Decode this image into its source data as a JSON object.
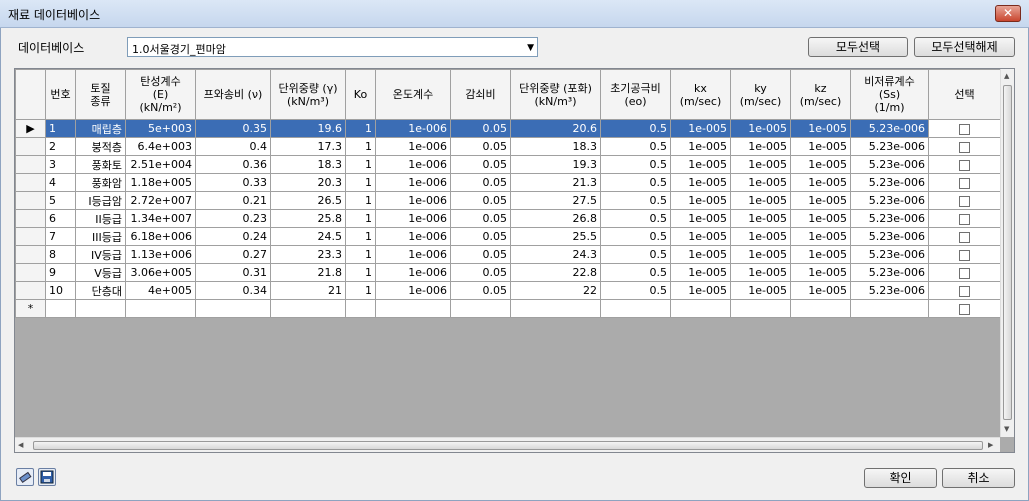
{
  "window": {
    "title": "재료 데이터베이스",
    "close_label": "✕"
  },
  "database": {
    "label": "데이터베이스",
    "selected": "1.0서울경기_편마암"
  },
  "buttons": {
    "select_all": "모두선택",
    "deselect_all": "모두선택해제",
    "ok": "확인",
    "cancel": "취소"
  },
  "headers": {
    "no": "번호",
    "soil": [
      "토질",
      "종류"
    ],
    "elastic": [
      "탄성계수",
      "(E)",
      "(kN/m²)"
    ],
    "poisson": "프와송비 (ν)",
    "unit_weight": [
      "단위중량 (γ)",
      "(kN/m³)"
    ],
    "ko": "Ko",
    "temp": "온도계수",
    "damping": "감쇠비",
    "sat_weight": [
      "단위중량 (포화)",
      "(kN/m³)"
    ],
    "void": [
      "초기공극비",
      "(eo)"
    ],
    "kx": [
      "kx",
      "(m/sec)"
    ],
    "ky": [
      "ky",
      "(m/sec)"
    ],
    "kz": [
      "kz",
      "(m/sec)"
    ],
    "storage": [
      "비저류계수",
      "(Ss)",
      "(1/m)"
    ],
    "select": "선택"
  },
  "rows": [
    {
      "no": "1",
      "soil": "매립층",
      "E": "5e+003",
      "nu": "0.35",
      "gamma": "19.6",
      "ko": "1",
      "temp": "1e-006",
      "damp": "0.05",
      "gsat": "20.6",
      "eo": "0.5",
      "kx": "1e-005",
      "ky": "1e-005",
      "kz": "1e-005",
      "ss": "5.23e-006",
      "selected": true
    },
    {
      "no": "2",
      "soil": "붕적층",
      "E": "6.4e+003",
      "nu": "0.4",
      "gamma": "17.3",
      "ko": "1",
      "temp": "1e-006",
      "damp": "0.05",
      "gsat": "18.3",
      "eo": "0.5",
      "kx": "1e-005",
      "ky": "1e-005",
      "kz": "1e-005",
      "ss": "5.23e-006"
    },
    {
      "no": "3",
      "soil": "풍화토",
      "E": "2.51e+004",
      "nu": "0.36",
      "gamma": "18.3",
      "ko": "1",
      "temp": "1e-006",
      "damp": "0.05",
      "gsat": "19.3",
      "eo": "0.5",
      "kx": "1e-005",
      "ky": "1e-005",
      "kz": "1e-005",
      "ss": "5.23e-006"
    },
    {
      "no": "4",
      "soil": "풍화암",
      "E": "1.18e+005",
      "nu": "0.33",
      "gamma": "20.3",
      "ko": "1",
      "temp": "1e-006",
      "damp": "0.05",
      "gsat": "21.3",
      "eo": "0.5",
      "kx": "1e-005",
      "ky": "1e-005",
      "kz": "1e-005",
      "ss": "5.23e-006"
    },
    {
      "no": "5",
      "soil": "I등급암",
      "E": "2.72e+007",
      "nu": "0.21",
      "gamma": "26.5",
      "ko": "1",
      "temp": "1e-006",
      "damp": "0.05",
      "gsat": "27.5",
      "eo": "0.5",
      "kx": "1e-005",
      "ky": "1e-005",
      "kz": "1e-005",
      "ss": "5.23e-006"
    },
    {
      "no": "6",
      "soil": "II등급",
      "E": "1.34e+007",
      "nu": "0.23",
      "gamma": "25.8",
      "ko": "1",
      "temp": "1e-006",
      "damp": "0.05",
      "gsat": "26.8",
      "eo": "0.5",
      "kx": "1e-005",
      "ky": "1e-005",
      "kz": "1e-005",
      "ss": "5.23e-006"
    },
    {
      "no": "7",
      "soil": "III등급",
      "E": "6.18e+006",
      "nu": "0.24",
      "gamma": "24.5",
      "ko": "1",
      "temp": "1e-006",
      "damp": "0.05",
      "gsat": "25.5",
      "eo": "0.5",
      "kx": "1e-005",
      "ky": "1e-005",
      "kz": "1e-005",
      "ss": "5.23e-006"
    },
    {
      "no": "8",
      "soil": "IV등급",
      "E": "1.13e+006",
      "nu": "0.27",
      "gamma": "23.3",
      "ko": "1",
      "temp": "1e-006",
      "damp": "0.05",
      "gsat": "24.3",
      "eo": "0.5",
      "kx": "1e-005",
      "ky": "1e-005",
      "kz": "1e-005",
      "ss": "5.23e-006"
    },
    {
      "no": "9",
      "soil": "V등급",
      "E": "3.06e+005",
      "nu": "0.31",
      "gamma": "21.8",
      "ko": "1",
      "temp": "1e-006",
      "damp": "0.05",
      "gsat": "22.8",
      "eo": "0.5",
      "kx": "1e-005",
      "ky": "1e-005",
      "kz": "1e-005",
      "ss": "5.23e-006"
    },
    {
      "no": "10",
      "soil": "단층대",
      "E": "4e+005",
      "nu": "0.34",
      "gamma": "21",
      "ko": "1",
      "temp": "1e-006",
      "damp": "0.05",
      "gsat": "22",
      "eo": "0.5",
      "kx": "1e-005",
      "ky": "1e-005",
      "kz": "1e-005",
      "ss": "5.23e-006"
    }
  ],
  "new_row_marker": "*",
  "current_row_marker": "▶",
  "icons": {
    "eraser": "eraser-icon",
    "save": "save-icon"
  },
  "colors": {
    "selection": "#3b6db5"
  }
}
